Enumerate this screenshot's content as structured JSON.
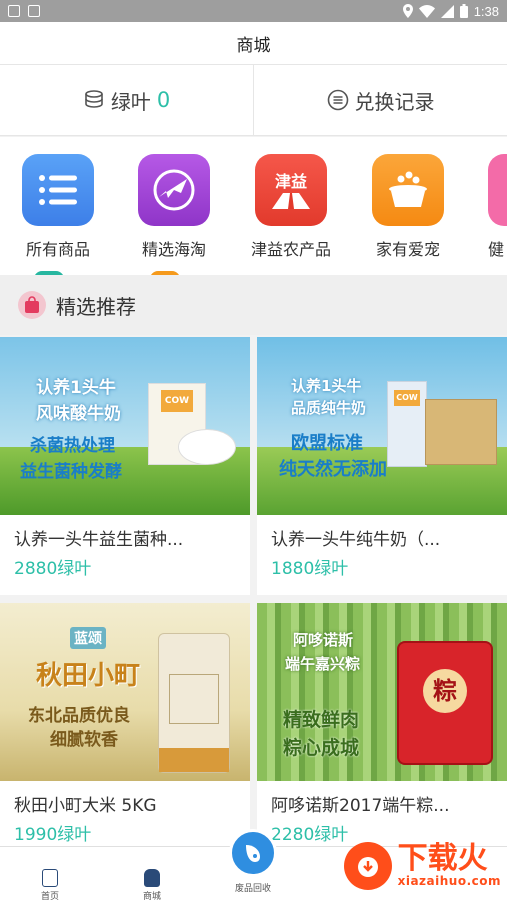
{
  "status_bar": {
    "time": "1:38"
  },
  "header": {
    "title": "商城"
  },
  "leaf_bar": {
    "leaf_label": "绿叶",
    "leaf_count": "0",
    "exchange_label": "兑换记录"
  },
  "categories": [
    {
      "label": "所有商品",
      "icon": "list-icon",
      "color": "#4a8ff0"
    },
    {
      "label": "精选海淘",
      "icon": "plane-icon",
      "color": "#a347d8"
    },
    {
      "label": "津益农产品",
      "icon": "farm-road-icon",
      "color": "#f04a3a"
    },
    {
      "label": "家有爱宠",
      "icon": "pet-bowl-icon",
      "color": "#f7951c"
    },
    {
      "label": "健",
      "icon": "health-icon",
      "color": "#f36ba8"
    }
  ],
  "section": {
    "title": "精选推荐",
    "icon": "bag-icon"
  },
  "products": [
    {
      "name": "认养一头牛益生菌种...",
      "price": "2880绿叶",
      "ad_lines": [
        "认养1头牛",
        "风味酸牛奶",
        "杀菌热处理",
        "益生菌种发酵"
      ],
      "pack_text": "COW"
    },
    {
      "name": "认养一头牛纯牛奶（...",
      "price": "1880绿叶",
      "ad_lines": [
        "认养1头牛",
        "品质纯牛奶",
        "欧盟标准",
        "纯天然无添加"
      ],
      "pack_text": "COW"
    },
    {
      "name": "秋田小町大米 5KG",
      "price": "1990绿叶",
      "ad_lines": [
        "蓝颂",
        "秋田小町",
        "东北品质优良",
        "细腻软香"
      ],
      "pack_text": ""
    },
    {
      "name": "阿哆诺斯2017端午粽...",
      "price": "2280绿叶",
      "ad_lines": [
        "阿哆诺斯",
        "端午嘉兴粽",
        "精致鲜肉",
        "粽心成城"
      ],
      "pack_text": "粽"
    }
  ],
  "tabbar": {
    "home": "首页",
    "mall": "商城",
    "recycle": "废品回收"
  },
  "watermark": {
    "brand": "下载火",
    "url": "xiazaihuo.com"
  }
}
